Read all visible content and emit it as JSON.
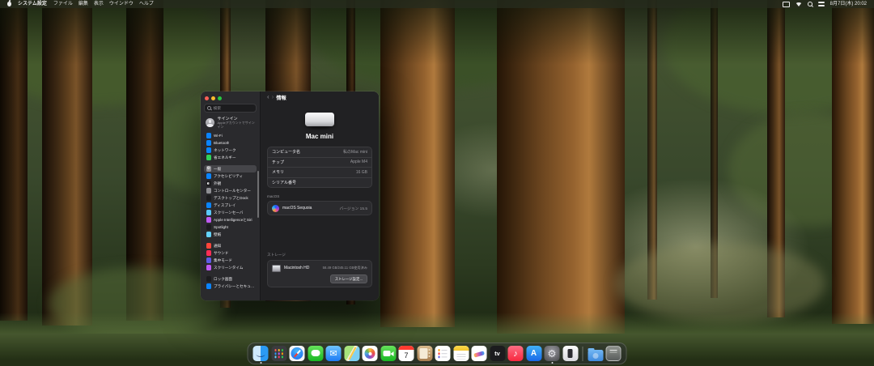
{
  "menu_bar": {
    "apple_logo": "apple-icon",
    "app_name": "システム設定",
    "menus": [
      "ファイル",
      "編集",
      "表示",
      "ウインドウ",
      "ヘルプ"
    ],
    "status_icons": [
      "screen-mirroring-icon",
      "wifi-icon",
      "search-icon",
      "control-center-icon"
    ],
    "clock": "8月7日(木) 20:02"
  },
  "window": {
    "nav_title": "情報",
    "sidebar": {
      "search_label": "検索",
      "account": {
        "name": "サインイン",
        "subtitle": "Appleアカウントでサインイン"
      },
      "groups": [
        {
          "items": [
            {
              "id": "wifi",
              "label": "Wi-Fi",
              "color": "#0a84ff"
            },
            {
              "id": "bluetooth",
              "label": "Bluetooth",
              "color": "#0a84ff"
            },
            {
              "id": "network",
              "label": "ネットワーク",
              "color": "#0a84ff"
            },
            {
              "id": "energy",
              "label": "省エネルギー",
              "color": "#30d158"
            }
          ]
        },
        {
          "items": [
            {
              "id": "general",
              "label": "一般",
              "color": "#8e8e93",
              "selected": true
            },
            {
              "id": "accessibility",
              "label": "アクセシビリティ",
              "color": "#0a84ff"
            },
            {
              "id": "appearance",
              "label": "外観",
              "color": "#1c1c1e"
            },
            {
              "id": "control-center",
              "label": "コントロールセンター",
              "color": "#8e8e93"
            },
            {
              "id": "desktop-dock",
              "label": "デスクトップとDock",
              "color": "#1c1c1e"
            },
            {
              "id": "displays",
              "label": "ディスプレイ",
              "color": "#0a84ff"
            },
            {
              "id": "screensaver",
              "label": "スクリーンセーバ",
              "color": "#5ac8fa"
            },
            {
              "id": "apple-intelligence",
              "label": "Apple IntelligenceとSiri",
              "color": "#bf5af2"
            },
            {
              "id": "spotlight",
              "label": "Spotlight",
              "color": "#1c1c1e"
            },
            {
              "id": "wallpaper",
              "label": "壁紙",
              "color": "#64d2ff"
            }
          ]
        },
        {
          "items": [
            {
              "id": "notifications",
              "label": "通知",
              "color": "#ff453a"
            },
            {
              "id": "sound",
              "label": "サウンド",
              "color": "#ff2d55"
            },
            {
              "id": "focus",
              "label": "集中モード",
              "color": "#5e5ce6"
            },
            {
              "id": "screen-time",
              "label": "スクリーンタイム",
              "color": "#bf5af2"
            }
          ]
        },
        {
          "items": [
            {
              "id": "lock-screen",
              "label": "ロック画面",
              "color": "#1c1c1e"
            },
            {
              "id": "privacy",
              "label": "プライバシーとセキュリティ",
              "color": "#0a84ff"
            }
          ]
        }
      ]
    },
    "about": {
      "device_title": "Mac mini",
      "rows": [
        {
          "id": "computer-name",
          "label": "コンピュータ名",
          "value": "私のMac mini"
        },
        {
          "id": "chip",
          "label": "チップ",
          "value": "Apple M4"
        },
        {
          "id": "memory",
          "label": "メモリ",
          "value": "16 GB"
        },
        {
          "id": "serial-number",
          "label": "シリアル番号",
          "value": ""
        }
      ],
      "macos_section": "macOS",
      "macos_name": "macOS Sequoia",
      "macos_version": "バージョン 15.5",
      "storage_section": "ストレージ",
      "storage_name": "Macintosh HD",
      "storage_usage": "58.49 GB/245.11 GB使用済み",
      "storage_button": "ストレージ設定..."
    }
  },
  "dock": {
    "items": [
      {
        "name": "finder",
        "label": "Finder",
        "running": true
      },
      {
        "name": "launchpad",
        "label": "Launchpad"
      },
      {
        "name": "safari",
        "label": "Safari"
      },
      {
        "name": "messages",
        "label": "メッセージ"
      },
      {
        "name": "mail",
        "label": "メール"
      },
      {
        "name": "maps",
        "label": "マップ"
      },
      {
        "name": "photos",
        "label": "写真"
      },
      {
        "name": "facetime",
        "label": "FaceTime"
      },
      {
        "name": "calendar",
        "label": "カレンダー",
        "day": "7"
      },
      {
        "name": "contacts",
        "label": "連絡先"
      },
      {
        "name": "reminders",
        "label": "リマインダー"
      },
      {
        "name": "notes",
        "label": "メモ"
      },
      {
        "name": "freeform",
        "label": "フリーボード"
      },
      {
        "name": "tv",
        "label": "Apple TV"
      },
      {
        "name": "music",
        "label": "ミュージック"
      },
      {
        "name": "appstore",
        "label": "App Store"
      },
      {
        "name": "settings",
        "label": "システム設定",
        "running": true
      },
      {
        "name": "iphone-mirroring",
        "label": "iPhoneミラーリング"
      },
      {
        "name": "separator"
      },
      {
        "name": "downloads",
        "label": "ダウンロード"
      },
      {
        "name": "trash",
        "label": "ゴミ箱"
      }
    ]
  }
}
